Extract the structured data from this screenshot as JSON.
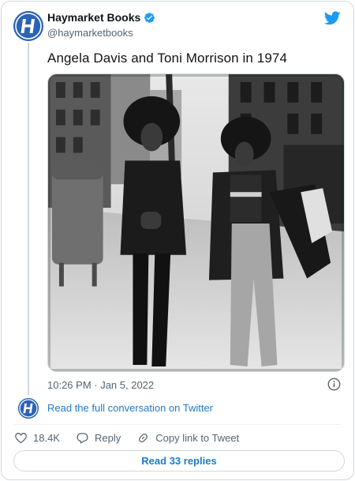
{
  "author": {
    "display_name": "Haymarket Books",
    "handle": "@haymarketbooks",
    "avatar_icon": "haymarket-h-logo",
    "avatar_color": "#2b63b6",
    "verified": true
  },
  "tweet": {
    "text": "Angela Davis and Toni Morrison in 1974",
    "timestamp": "10:26 PM · Jan 5, 2022"
  },
  "conversation": {
    "link_label": "Read the full conversation on Twitter"
  },
  "actions": {
    "likes_count": "18.4K",
    "reply_label": "Reply",
    "copy_link_label": "Copy link to Tweet"
  },
  "replies": {
    "button_label": "Read 33 replies"
  },
  "colors": {
    "link": "#1d7bc9",
    "twitter_blue": "#1d9bf0",
    "muted_text": "#536471",
    "border": "#cfd9de"
  },
  "icons": [
    "twitter-bird-icon",
    "verified-badge-icon",
    "info-icon",
    "heart-icon",
    "reply-bubble-icon",
    "link-icon"
  ]
}
